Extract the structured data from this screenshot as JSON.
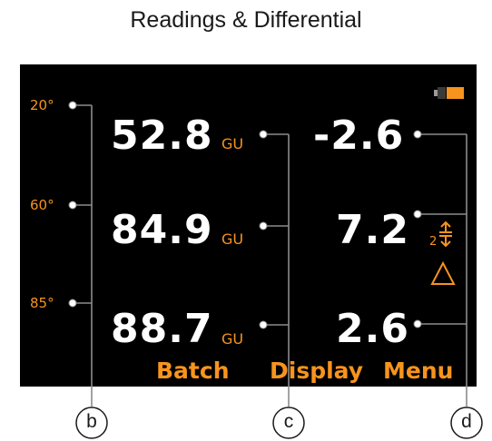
{
  "title": "Readings & Differential",
  "angles": [
    "20°",
    "60°",
    "85°"
  ],
  "readings": [
    {
      "value": "52.8",
      "unit": "GU"
    },
    {
      "value": "84.9",
      "unit": "GU"
    },
    {
      "value": "88.7",
      "unit": "GU"
    }
  ],
  "differentials": [
    "-2.6",
    "7.2",
    "2.6"
  ],
  "differential_indicator": {
    "label": "2",
    "icon": "up-down-arrow-icon"
  },
  "delta_icon": "delta-triangle-icon",
  "softkeys": {
    "batch": "Batch",
    "display": "Display",
    "menu": "Menu"
  },
  "callouts": {
    "b": "b",
    "c": "c",
    "d": "d"
  },
  "battery_icon": "battery-icon",
  "colors": {
    "accent": "#f7941d",
    "screen_bg": "#000000",
    "text": "#ffffff",
    "callout_line": "#8c8c8c"
  }
}
